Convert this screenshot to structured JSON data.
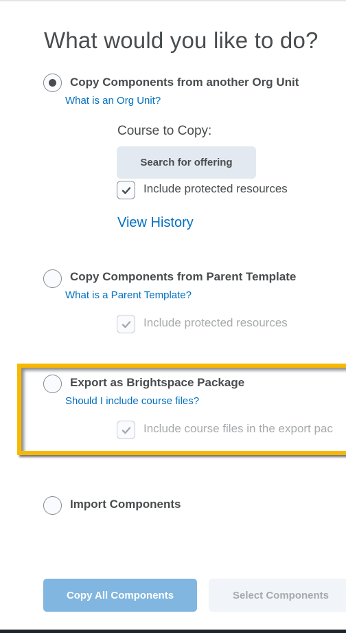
{
  "page": {
    "title": "What would you like to do?"
  },
  "options": [
    {
      "label": "Copy Components from another Org Unit",
      "help_link": "What is an Org Unit?",
      "selected": true,
      "course_to_copy_label": "Course to Copy:",
      "search_button": "Search for offering",
      "checkbox_label": "Include protected resources",
      "checkbox_checked": true,
      "checkbox_disabled": false,
      "view_history": "View History"
    },
    {
      "label": "Copy Components from Parent Template",
      "help_link": "What is a Parent Template?",
      "selected": false,
      "checkbox_label": "Include protected resources",
      "checkbox_checked": true,
      "checkbox_disabled": true
    },
    {
      "label": "Export as Brightspace Package",
      "help_link": "Should I include course files?",
      "selected": false,
      "checkbox_label": "Include course files in the export pac",
      "checkbox_checked": true,
      "checkbox_disabled": true,
      "highlighted": true,
      "highlight_color": "#f9b800"
    },
    {
      "label": "Import Components",
      "selected": false
    }
  ],
  "actions": {
    "primary": "Copy All Components",
    "secondary": "Select Components"
  },
  "colors": {
    "link": "#006fbf",
    "primary_button": "#80b6df",
    "highlight": "#f9b800"
  }
}
